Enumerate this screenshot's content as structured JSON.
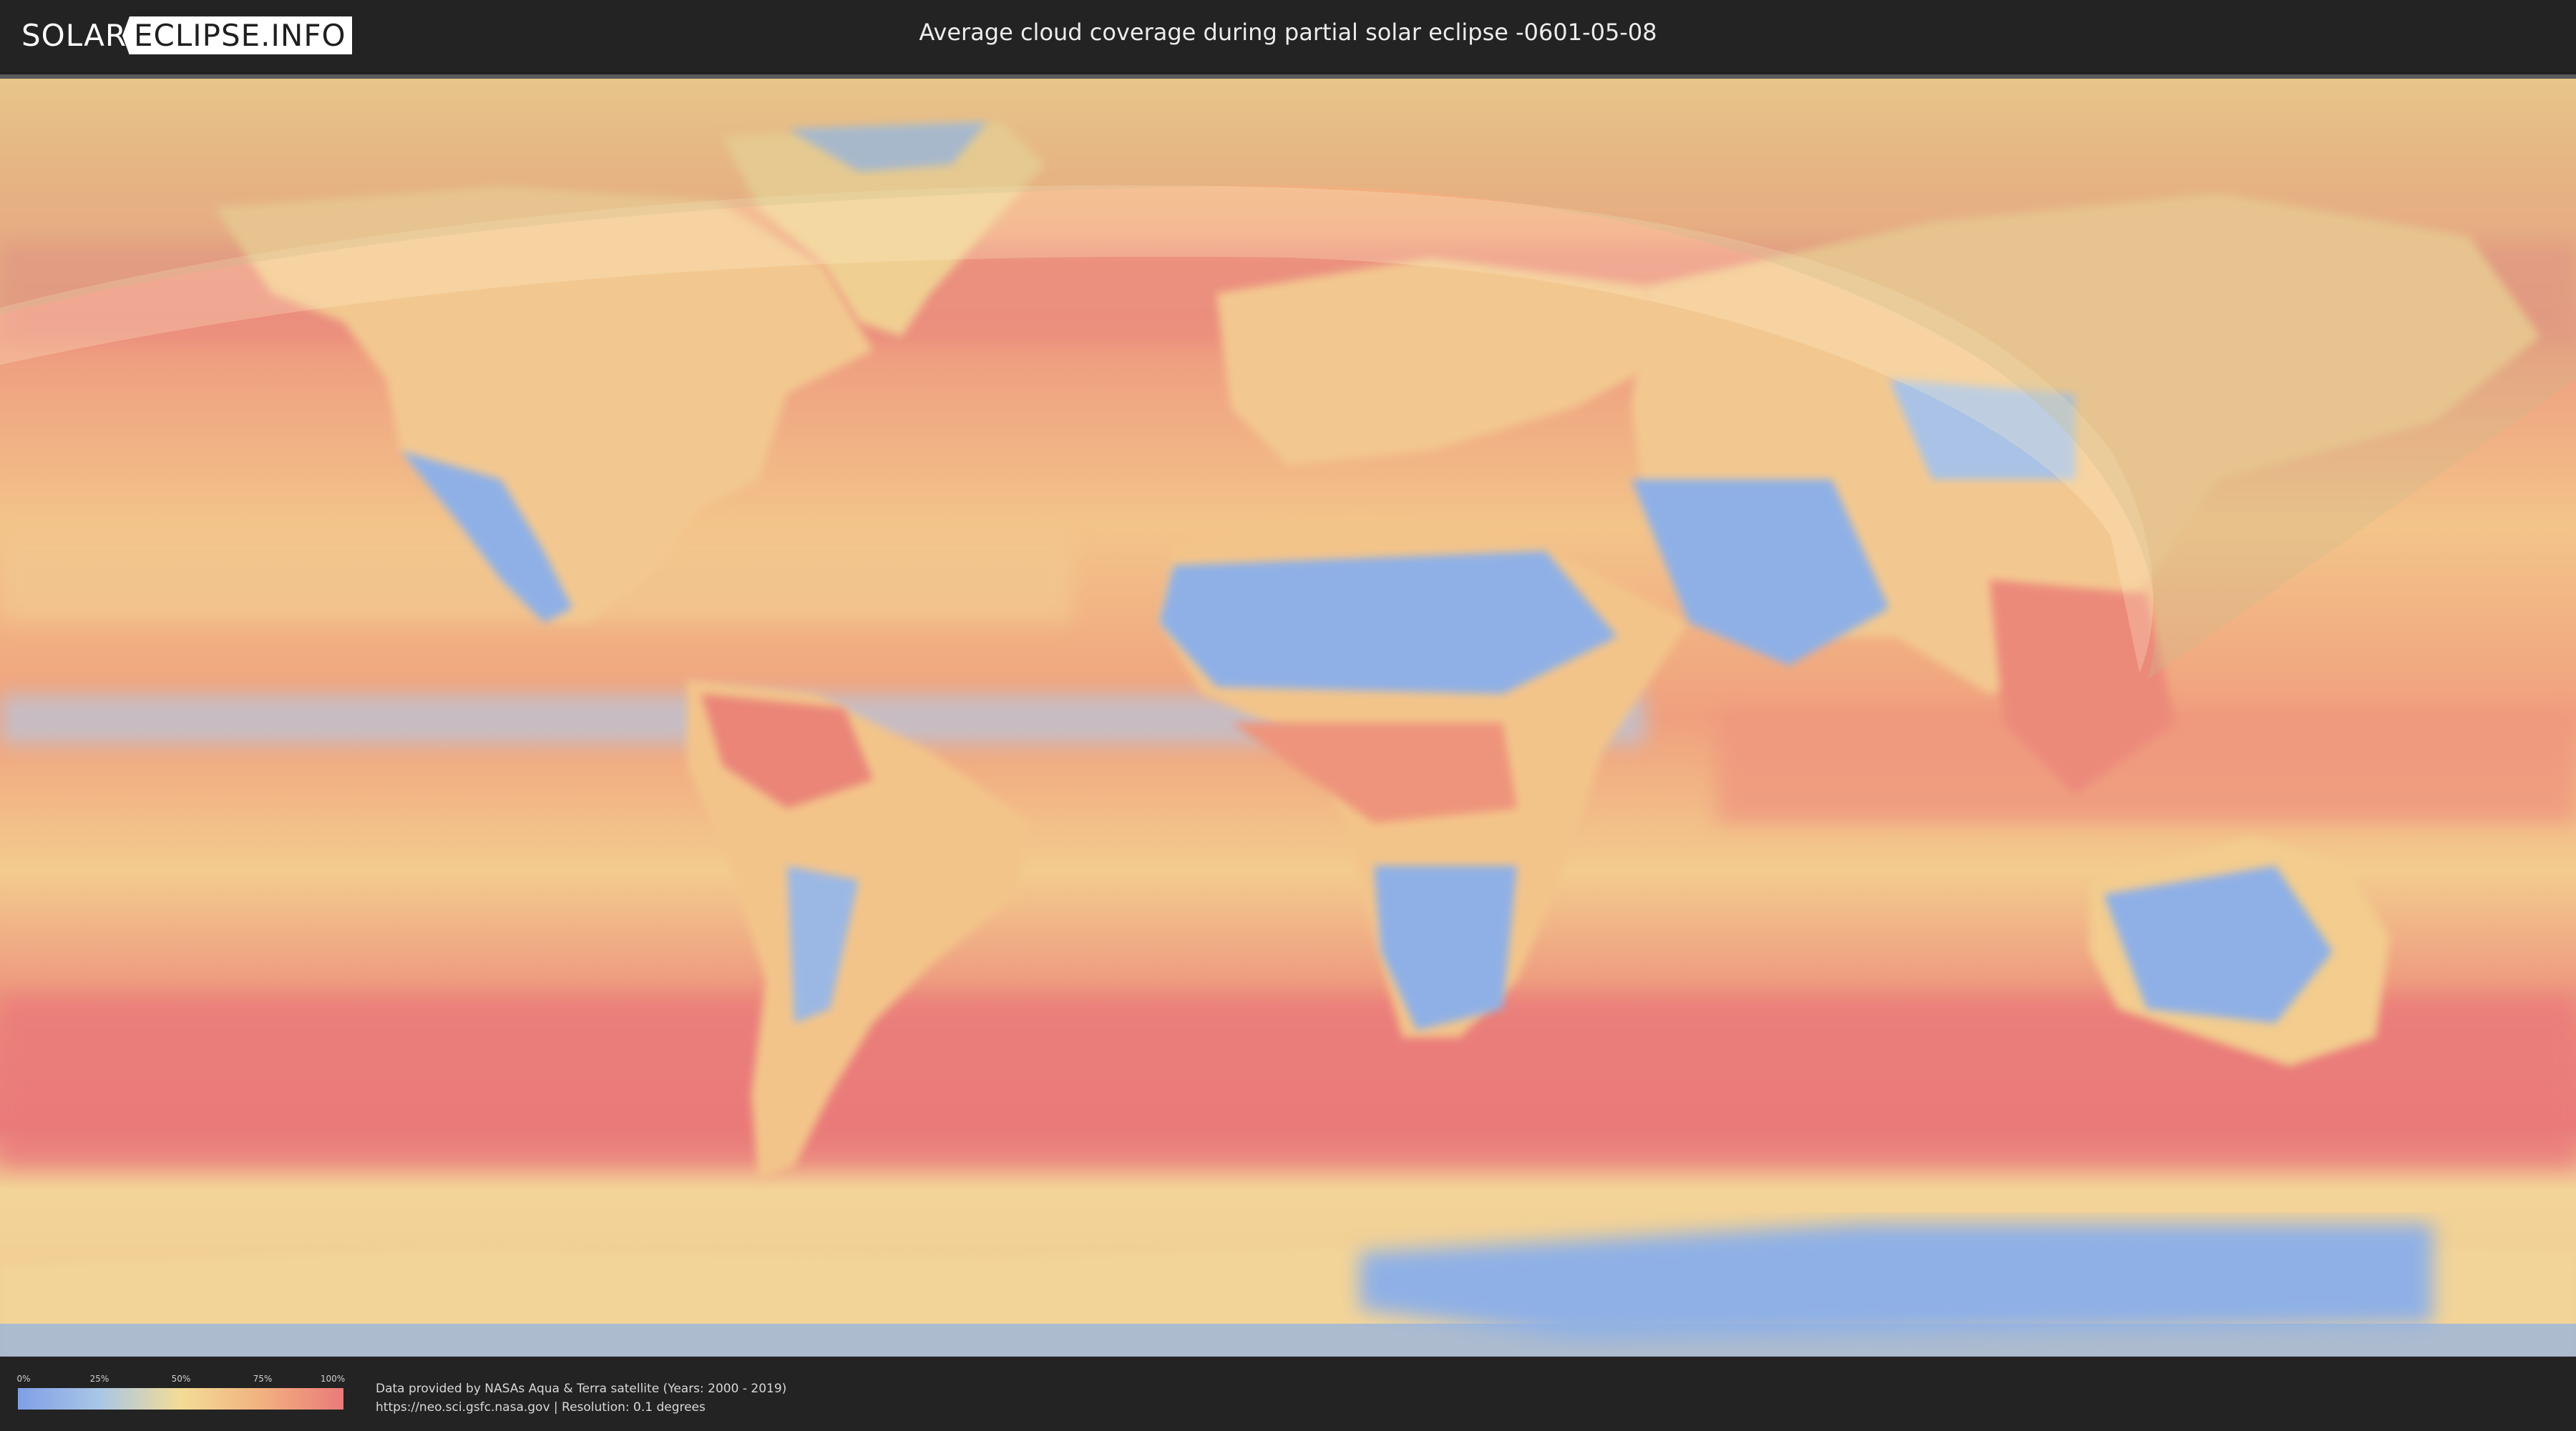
{
  "header": {
    "logo_part1": "SOLAR",
    "logo_part2": "ECLIPSE.INFO",
    "title": "Average cloud coverage during partial solar eclipse -0601-05-08"
  },
  "legend": {
    "ticks": [
      "0%",
      "25%",
      "50%",
      "75%",
      "100%"
    ],
    "tick_values": [
      0,
      25,
      50,
      75,
      100
    ],
    "colors": [
      "#7f9fe6",
      "#a9c6e6",
      "#f3dc96",
      "#f2b07f",
      "#ea7a7a"
    ]
  },
  "credits": {
    "line1": "Data provided by NASAs Aqua & Terra satellite (Years: 2000 - 2019)",
    "line2": "https://neo.sci.gsfc.nasa.gov | Resolution: 0.1 degrees"
  },
  "map": {
    "icon": "world-cloud-coverage-map",
    "ocean_color": "#f2b27e",
    "cloudy_color": "#ea7a7a",
    "clear_color": "#8fb0e6",
    "ice_color": "#f4d99a",
    "eclipse_shadow_color": "#d9c79a"
  }
}
